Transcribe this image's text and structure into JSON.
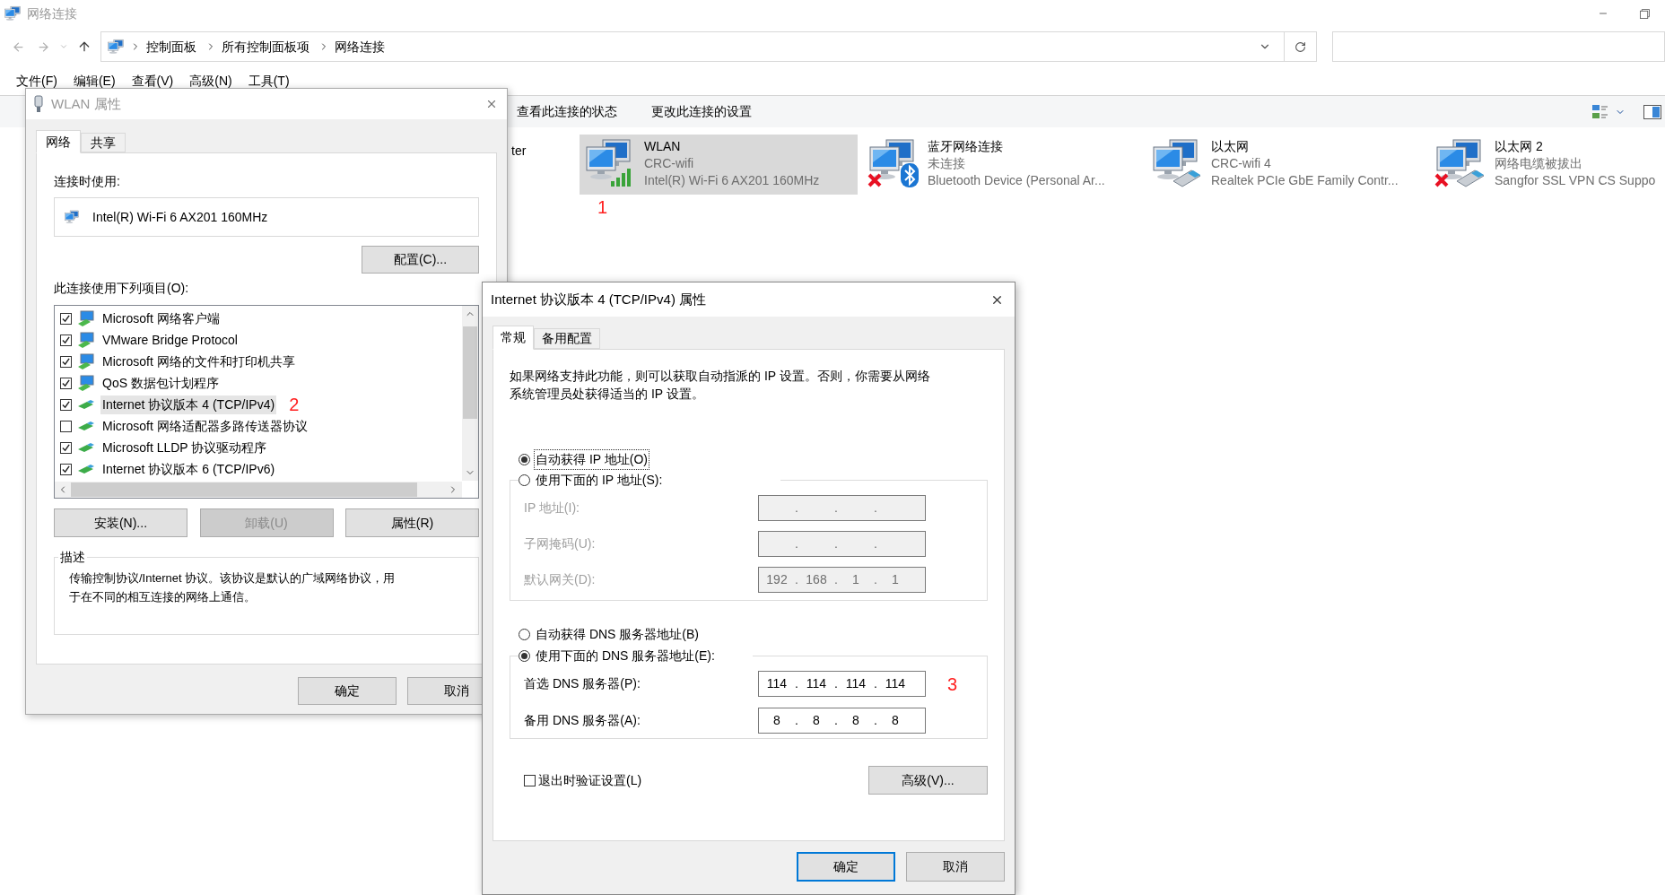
{
  "explorer": {
    "title": "网络连接",
    "breadcrumb": [
      "控制面板",
      "所有控制面板项",
      "网络连接"
    ],
    "menu": [
      "文件(F)",
      "编辑(E)",
      "查看(V)",
      "高级(N)",
      "工具(T)"
    ],
    "commands": [
      "查看此连接的状态",
      "更改此连接的设置"
    ],
    "partial_item": "ter",
    "connections": [
      {
        "name": "WLAN",
        "status": "CRC-wifi",
        "device": "Intel(R) Wi-Fi 6 AX201 160MHz",
        "kind": "wifi",
        "disconnected": false,
        "selected": true,
        "annotation": "1"
      },
      {
        "name": "蓝牙网络连接",
        "status": "未连接",
        "device": "Bluetooth Device (Personal Ar...",
        "kind": "bluetooth",
        "disconnected": true,
        "selected": false
      },
      {
        "name": "以太网",
        "status": "CRC-wifi 4",
        "device": "Realtek PCIe GbE Family Contr...",
        "kind": "ethernet",
        "disconnected": false,
        "selected": false
      },
      {
        "name": "以太网 2",
        "status": "网络电缆被拔出",
        "device": "Sangfor SSL VPN CS Suppo",
        "kind": "ethernet",
        "disconnected": true,
        "selected": false
      }
    ]
  },
  "wlan_dialog": {
    "title": "WLAN 属性",
    "tabs": [
      {
        "label": "网络",
        "selected": true
      },
      {
        "label": "共享",
        "selected": false
      }
    ],
    "connect_using_label": "连接时使用:",
    "adapter": "Intel(R) Wi-Fi 6 AX201 160MHz",
    "configure_button": "配置(C)...",
    "items_label": "此连接使用下列项目(O):",
    "items": [
      {
        "label": "Microsoft 网络客户端",
        "kind": "service",
        "checked": true,
        "selected": false
      },
      {
        "label": "VMware Bridge Protocol",
        "kind": "service",
        "checked": true,
        "selected": false
      },
      {
        "label": "Microsoft 网络的文件和打印机共享",
        "kind": "service",
        "checked": true,
        "selected": false
      },
      {
        "label": "QoS 数据包计划程序",
        "kind": "service",
        "checked": true,
        "selected": false
      },
      {
        "label": "Internet 协议版本 4 (TCP/IPv4)",
        "kind": "protocol",
        "checked": true,
        "selected": true,
        "annotation": "2"
      },
      {
        "label": "Microsoft 网络适配器多路传送器协议",
        "kind": "protocol",
        "checked": false,
        "selected": false
      },
      {
        "label": "Microsoft LLDP 协议驱动程序",
        "kind": "protocol",
        "checked": true,
        "selected": false
      },
      {
        "label": "Internet 协议版本 6 (TCP/IPv6)",
        "kind": "protocol",
        "checked": true,
        "selected": false
      }
    ],
    "buttons": [
      {
        "label": "安装(N)...",
        "disabled": false
      },
      {
        "label": "卸载(U)",
        "disabled": true
      },
      {
        "label": "属性(R)",
        "disabled": false
      }
    ],
    "description_label": "描述",
    "description": "传输控制协议/Internet 协议。该协议是默认的广域网络协议，用于在不同的相互连接的网络上通信。",
    "ok_button": "确定",
    "cancel_button": "取消"
  },
  "ipv4_dialog": {
    "title": "Internet 协议版本 4 (TCP/IPv4) 属性",
    "tabs": [
      {
        "label": "常规",
        "selected": true
      },
      {
        "label": "备用配置",
        "selected": false
      }
    ],
    "intro": "如果网络支持此功能，则可以获取自动指派的 IP 设置。否则，你需要从网络系统管理员处获得适当的 IP 设置。",
    "separator": ".",
    "ip_options": [
      {
        "label": "自动获得 IP 地址(O)",
        "selected": true,
        "focused": true
      },
      {
        "label": "使用下面的 IP 地址(S):",
        "selected": false,
        "focused": false
      }
    ],
    "ip_fields": [
      {
        "label": "IP 地址(I):",
        "disabled": true
      },
      {
        "label": "子网掩码(U):",
        "disabled": true
      },
      {
        "label": "默认网关(D):",
        "octets": [
          "192",
          "168",
          "1",
          "1"
        ],
        "disabled": true
      }
    ],
    "dns_options": [
      {
        "label": "自动获得 DNS 服务器地址(B)",
        "selected": false,
        "focused": false
      },
      {
        "label": "使用下面的 DNS 服务器地址(E):",
        "selected": true,
        "focused": false
      }
    ],
    "dns_fields": [
      {
        "label": "首选 DNS 服务器(P):",
        "octets": [
          "114",
          "114",
          "114",
          "114"
        ],
        "disabled": false,
        "annotation": "3"
      },
      {
        "label": "备用 DNS 服务器(A):",
        "octets": [
          "8",
          "8",
          "8",
          "8"
        ],
        "disabled": false
      }
    ],
    "validate_checkbox": {
      "label": "退出时验证设置(L)",
      "checked": false
    },
    "advanced_button": "高级(V)...",
    "ok_button": "确定",
    "cancel_button": "取消"
  }
}
